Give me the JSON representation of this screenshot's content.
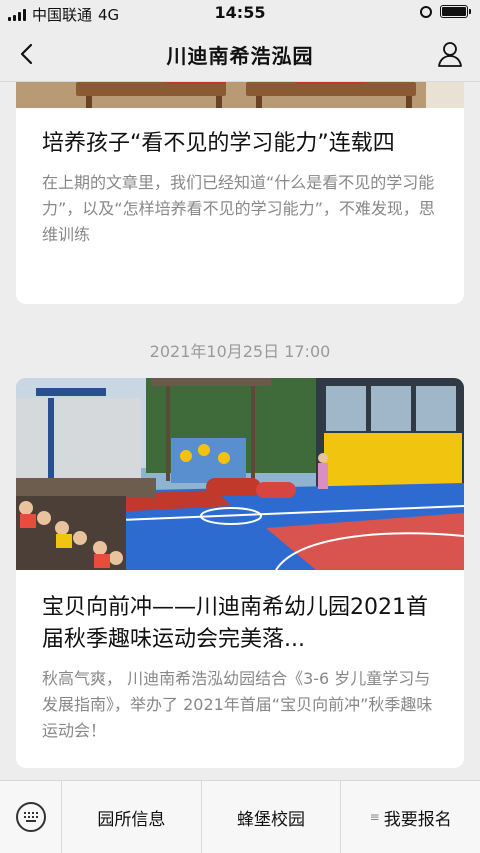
{
  "status": {
    "carrier": "中国联通",
    "network": "4G",
    "time": "14:55"
  },
  "nav": {
    "title": "川迪南希浩泓园",
    "back_icon": "chevron-left-icon",
    "profile_icon": "user-icon"
  },
  "articles": [
    {
      "title": "培养孩子“看不见的学习能力”连载四",
      "summary": "在上期的文章里，我们已经知道“什么是看不见的学习能力”，以及“怎样培养看不见的学习能力”，不难发现，思维训练"
    },
    {
      "timestamp": "2021年10月25日 17:00",
      "title": "宝贝向前冲——川迪南希幼儿园2021首届秋季趣味运动会完美落...",
      "summary": "秋高气爽， 川迪南希浩泓幼园结合《3-6 岁儿童学习与发展指南》，举办了 2021年首届“宝贝向前冲”秋季趣味运动会！"
    }
  ],
  "bottom_menu": {
    "keyboard_icon": "keyboard-icon",
    "items": [
      {
        "label": "园所信息"
      },
      {
        "label": "蜂堡校园"
      },
      {
        "label": "我要报名",
        "has_submenu": true
      }
    ]
  }
}
